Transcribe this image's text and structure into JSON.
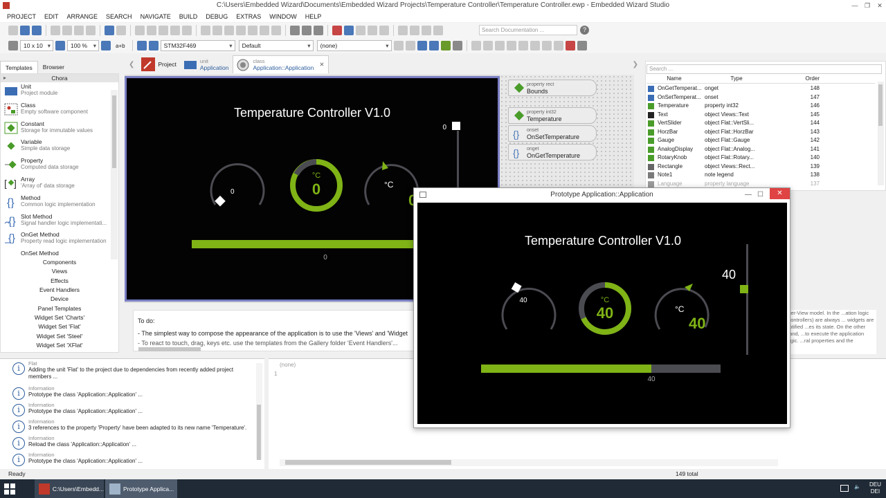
{
  "window": {
    "title": "C:\\Users\\Embedded Wizard\\Documents\\Embedded Wizard Projects\\Temperature Controller\\Temperature Controller.ewp - Embedded Wizard Studio"
  },
  "menu": [
    "PROJECT",
    "EDIT",
    "ARRANGE",
    "SEARCH",
    "NAVIGATE",
    "BUILD",
    "DEBUG",
    "EXTRAS",
    "WINDOW",
    "HELP"
  ],
  "toolbar": {
    "grid": "10 x 10",
    "zoom": "100 %",
    "ab": "a+b",
    "target": "STM32F469",
    "style": "Default",
    "variant": "(none)",
    "search_placeholder": "Search Documentation ..."
  },
  "left_tabs": [
    "Templates",
    "Browser"
  ],
  "palette": {
    "header": "Chora",
    "items": [
      {
        "title": "Unit",
        "desc": "Project module"
      },
      {
        "title": "Class",
        "desc": "Empty software component"
      },
      {
        "title": "Constant",
        "desc": "Storage for immutable values"
      },
      {
        "title": "Variable",
        "desc": "Simple data storage"
      },
      {
        "title": "Property",
        "desc": "Computed data storage"
      },
      {
        "title": "Array",
        "desc": "'Array of' data storage"
      },
      {
        "title": "Method",
        "desc": "Common logic implementation"
      },
      {
        "title": "Slot Method",
        "desc": "Signal handler logic implementati..."
      },
      {
        "title": "OnGet Method",
        "desc": "Property read logic implementation"
      },
      {
        "title": "OnSet Method",
        "desc": ""
      }
    ],
    "categories": [
      "Components",
      "Views",
      "Effects",
      "Event Handlers",
      "Device",
      "Panel Templates",
      "Widget Set 'Charts'",
      "Widget Set 'Flat'",
      "Widget Set 'Steel'",
      "Widget Set 'XFlat'"
    ]
  },
  "doc_tabs": [
    {
      "small": "",
      "label": "Project"
    },
    {
      "small": "unit",
      "label": "Application"
    },
    {
      "small": "class",
      "label": "Application::Application"
    }
  ],
  "editor": {
    "title": "Temperature Controller V1.0",
    "left_gauge_value": "0",
    "center_unit": "°C",
    "center_value": "0",
    "right_unit": "°C",
    "right_value": "0",
    "slider_value": "0",
    "bar_value": "0",
    "bar_fill": 0.82
  },
  "members": [
    {
      "kind": "property rect",
      "name": "Bounds"
    },
    {
      "kind": "property int32",
      "name": "Temperature"
    },
    {
      "kind": "onset",
      "name": "OnSetTemperature"
    },
    {
      "kind": "onget",
      "name": "OnGetTemperature"
    }
  ],
  "inspector": {
    "search_placeholder": "Search ...",
    "columns": [
      "Name",
      "Type",
      "Order"
    ],
    "rows": [
      {
        "name": "OnGetTemperat...",
        "type": "onget",
        "order": "148"
      },
      {
        "name": "OnSetTemperat...",
        "type": "onset",
        "order": "147"
      },
      {
        "name": "Temperature",
        "type": "property int32",
        "order": "146"
      },
      {
        "name": "Text",
        "type": "object Views::Text",
        "order": "145"
      },
      {
        "name": "VertSlider",
        "type": "object Flat::VertSli...",
        "order": "144"
      },
      {
        "name": "HorzBar",
        "type": "object Flat::HorzBar",
        "order": "143"
      },
      {
        "name": "Gauge",
        "type": "object Flat::Gauge",
        "order": "142"
      },
      {
        "name": "AnalogDisplay",
        "type": "object Flat::Analog...",
        "order": "141"
      },
      {
        "name": "RotaryKnob",
        "type": "object Flat::Rotary...",
        "order": "140"
      },
      {
        "name": "Rectangle",
        "type": "object Views::Rect...",
        "order": "139"
      },
      {
        "name": "Note1",
        "type": "note legend",
        "order": "138"
      },
      {
        "name": "Language",
        "type": "property language",
        "order": "137"
      }
    ],
    "note": "...er-View model. In the ...ation logic (controllers) are always ... widgets are notified ...es its state. On the other hand, ...to execute the application logic. ...ral properties and the"
  },
  "code": {
    "lines": [
      "To do:",
      "- The simplest way to compose the appearance of the application is to use the 'Views' and 'Widget",
      "- To react to touch, drag, keys etc. use the templates from the Gallery folder 'Event Handlers'..."
    ]
  },
  "messages": [
    {
      "head": "Flat",
      "text": "Adding the unit 'Flat' to the project due to dependencies from recently added project members ..."
    },
    {
      "head": "Information",
      "text": "Prototype the class 'Application::Application' ..."
    },
    {
      "head": "Information",
      "text": "Prototype the class 'Application::Application' ..."
    },
    {
      "head": "Information",
      "text": "3 references to the property 'Property' have been adapted to its new name 'Temperature'."
    },
    {
      "head": "Information",
      "text": "Reload the class 'Application::Application' ..."
    },
    {
      "head": "Information",
      "text": "Prototype the class 'Application::Application' ..."
    }
  ],
  "output": {
    "header": "(none)",
    "line": "1"
  },
  "status": {
    "left": "Ready",
    "count": "149 total"
  },
  "taskbar": {
    "items": [
      "C:\\Users\\Embedd...",
      "Prototype Applica..."
    ],
    "lang1": "DEU",
    "lang2": "DEI"
  },
  "prototype": {
    "title": "Prototype Application::Application",
    "screen_title": "Temperature Controller V1.0",
    "left_gauge_value": "40",
    "center_unit": "°C",
    "center_value": "40",
    "right_unit": "°C",
    "right_value": "40",
    "slider_value": "40",
    "bar_value": "40",
    "bar_fill": 0.71
  },
  "colors": {
    "accent": "#7fb316",
    "dark": "#000000",
    "track": "#4b4b52",
    "frame": "#7b7fc4"
  }
}
